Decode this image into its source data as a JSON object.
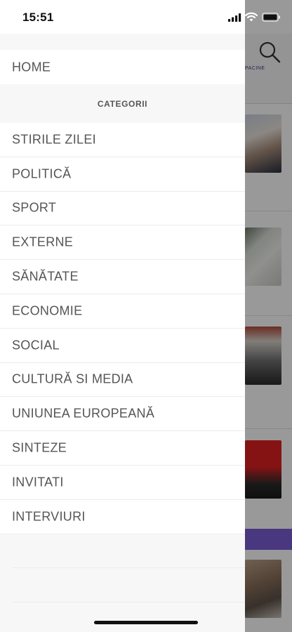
{
  "status_bar": {
    "time": "15:51",
    "icons": [
      "cellular-signal-icon",
      "wifi-icon",
      "battery-icon"
    ]
  },
  "drawer": {
    "home": {
      "label": "HOME"
    },
    "section_title": "CATEGORII",
    "categories": [
      {
        "label": "STIRILE ZILEI"
      },
      {
        "label": "POLITICĂ"
      },
      {
        "label": "SPORT"
      },
      {
        "label": "EXTERNE"
      },
      {
        "label": "SĂNĂTATE"
      },
      {
        "label": "ECONOMIE"
      },
      {
        "label": "SOCIAL"
      },
      {
        "label": "CULTURĂ SI MEDIA"
      },
      {
        "label": "UNIUNEA EUROPEANĂ"
      },
      {
        "label": "SINTEZE"
      },
      {
        "label": "INVITATI"
      },
      {
        "label": "INTERVIURI"
      }
    ]
  },
  "background_app": {
    "search_icon": "search-icon",
    "logo_fragment": "PACINE",
    "accent_color": "#7b5cd6"
  },
  "colors": {
    "menu_text": "#555555",
    "drawer_background": "#f7f7f7",
    "row_background": "#ffffff",
    "divider": "#ececec"
  }
}
